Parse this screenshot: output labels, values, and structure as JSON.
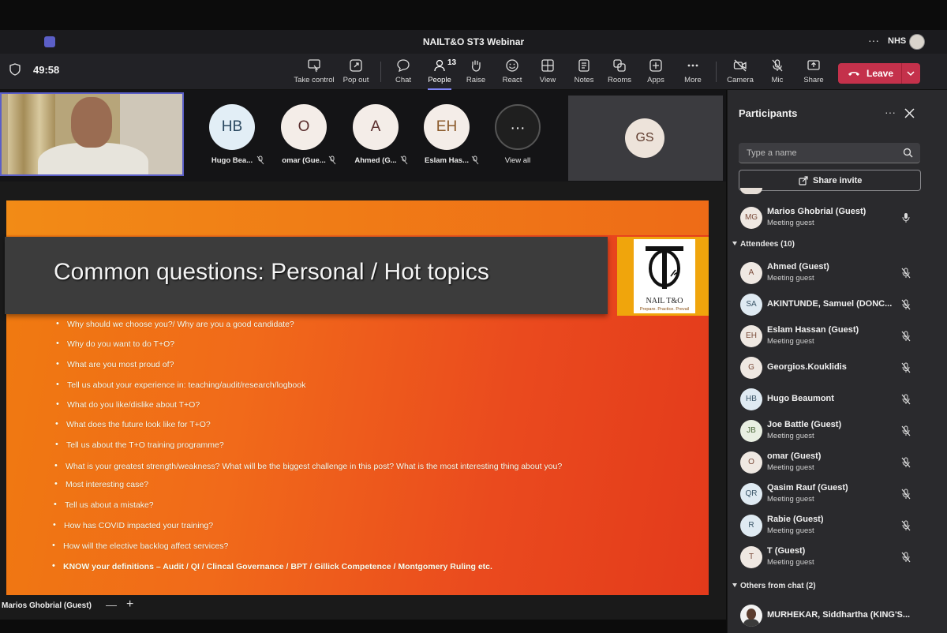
{
  "window": {
    "title": "NAILT&O ST3 Webinar",
    "org": "NHS",
    "more": "···"
  },
  "toolbar": {
    "timer": "49:58",
    "buttons": [
      {
        "label": "Take control",
        "icon": "take-control-icon"
      },
      {
        "label": "Pop out",
        "icon": "pop-out-icon"
      },
      {
        "label": "Chat",
        "icon": "chat-icon"
      },
      {
        "label": "People",
        "icon": "people-icon",
        "count": "13"
      },
      {
        "label": "Raise",
        "icon": "raise-hand-icon"
      },
      {
        "label": "React",
        "icon": "react-icon"
      },
      {
        "label": "View",
        "icon": "view-icon"
      },
      {
        "label": "Notes",
        "icon": "notes-icon"
      },
      {
        "label": "Rooms",
        "icon": "rooms-icon"
      },
      {
        "label": "Apps",
        "icon": "apps-icon"
      },
      {
        "label": "More",
        "icon": "more-icon"
      },
      {
        "label": "Camera",
        "icon": "camera-off-icon"
      },
      {
        "label": "Mic",
        "icon": "mic-off-icon"
      },
      {
        "label": "Share",
        "icon": "share-icon"
      }
    ],
    "leave_label": "Leave",
    "accent": "#c4314b"
  },
  "strip": {
    "tiles": [
      {
        "initials": "HB",
        "name": "Hugo Bea..."
      },
      {
        "initials": "O",
        "name": "omar (Gue..."
      },
      {
        "initials": "A",
        "name": "Ahmed (G..."
      },
      {
        "initials": "EH",
        "name": "Eslam Has..."
      },
      {
        "initials": "···",
        "name": "View all"
      }
    ],
    "spotlight_initials": "GS"
  },
  "slide": {
    "title": "Common questions: Personal / Hot topics",
    "logo_text": "NAIL T&O",
    "logo_tagline": "Prepare. Practice. Prevail",
    "questions": [
      "Why should we choose you?/ Why are you a good candidate?",
      "Why do you want to do T+O?",
      "What are you most proud of?",
      "Tell us about your experience in: teaching/audit/research/logbook",
      "What do you like/dislike about T+O?",
      "What does the future look like for T+O?",
      "Tell us about the T+O training programme?",
      "What is your greatest strength/weakness? What will be the biggest challenge in this post? What is the most interesting thing about you?",
      "Most interesting case?",
      "Tell us about a mistake?",
      "How has COVID impacted your training?",
      "How will the elective backlog affect services?",
      "KNOW your definitions – Audit / QI / Clincal Governance / BPT / Gillick Competence / Montgomery Ruling etc."
    ]
  },
  "presenter": {
    "name": "Marios Ghobrial (Guest)",
    "zoom_out": "—",
    "zoom_in": "+"
  },
  "panel": {
    "title": "Participants",
    "more": "···",
    "search_placeholder": "Type a name",
    "share_invite": "Share invite",
    "presenter": {
      "initials": "MG",
      "name": "Marios Ghobrial (Guest)",
      "role": "Meeting guest"
    },
    "attendees_header": "Attendees (10)",
    "attendees": [
      {
        "initials": "A",
        "name": "Ahmed (Guest)",
        "role": "Meeting guest"
      },
      {
        "initials": "SA",
        "name": "AKINTUNDE, Samuel (DONC...",
        "role": ""
      },
      {
        "initials": "EH",
        "name": "Eslam Hassan (Guest)",
        "role": "Meeting guest"
      },
      {
        "initials": "G",
        "name": "Georgios.Kouklidis",
        "role": ""
      },
      {
        "initials": "HB",
        "name": "Hugo Beaumont",
        "role": ""
      },
      {
        "initials": "JB",
        "name": "Joe Battle (Guest)",
        "role": "Meeting guest"
      },
      {
        "initials": "O",
        "name": "omar (Guest)",
        "role": "Meeting guest"
      },
      {
        "initials": "QR",
        "name": "Qasim Rauf (Guest)",
        "role": "Meeting guest"
      },
      {
        "initials": "R",
        "name": "Rabie (Guest)",
        "role": "Meeting guest"
      },
      {
        "initials": "T",
        "name": "T (Guest)",
        "role": "Meeting guest"
      }
    ],
    "others_header": "Others from chat (2)",
    "others": [
      {
        "name": "MURHEKAR, Siddhartha (KING'S..."
      }
    ]
  }
}
